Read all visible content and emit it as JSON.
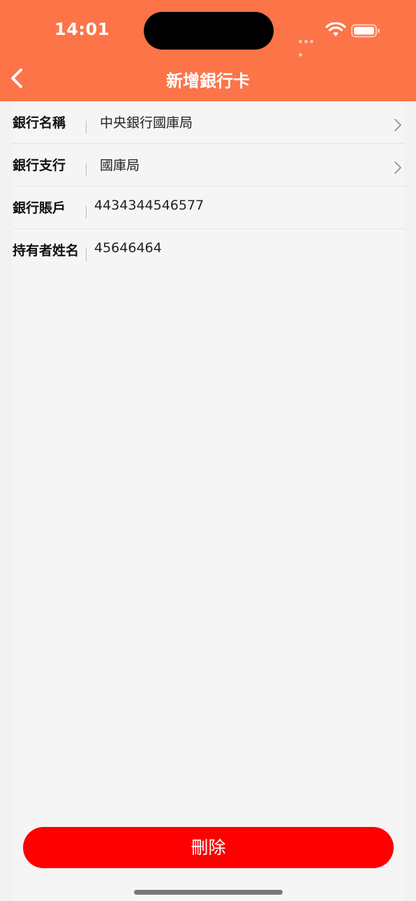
{
  "status_bar": {
    "time": "14:01",
    "icons": [
      "cellular-icon",
      "wifi-icon",
      "battery-icon"
    ]
  },
  "nav": {
    "back_icon": "chevron-left-icon",
    "title": "新增銀行卡"
  },
  "form": {
    "rows": [
      {
        "label": "銀行名稱",
        "value": "中央銀行國庫局",
        "has_chevron": true
      },
      {
        "label": "銀行支行",
        "value": "國庫局",
        "has_chevron": true
      },
      {
        "label": "銀行賬戶",
        "value": "4434344546577",
        "has_chevron": false
      },
      {
        "label": "持有者姓名",
        "value": "45646464",
        "has_chevron": false
      }
    ]
  },
  "actions": {
    "delete_label": "刪除"
  },
  "colors": {
    "header_bg": "#fc7448",
    "delete_bg": "#ff0000",
    "page_bg": "#f5f5f5"
  }
}
